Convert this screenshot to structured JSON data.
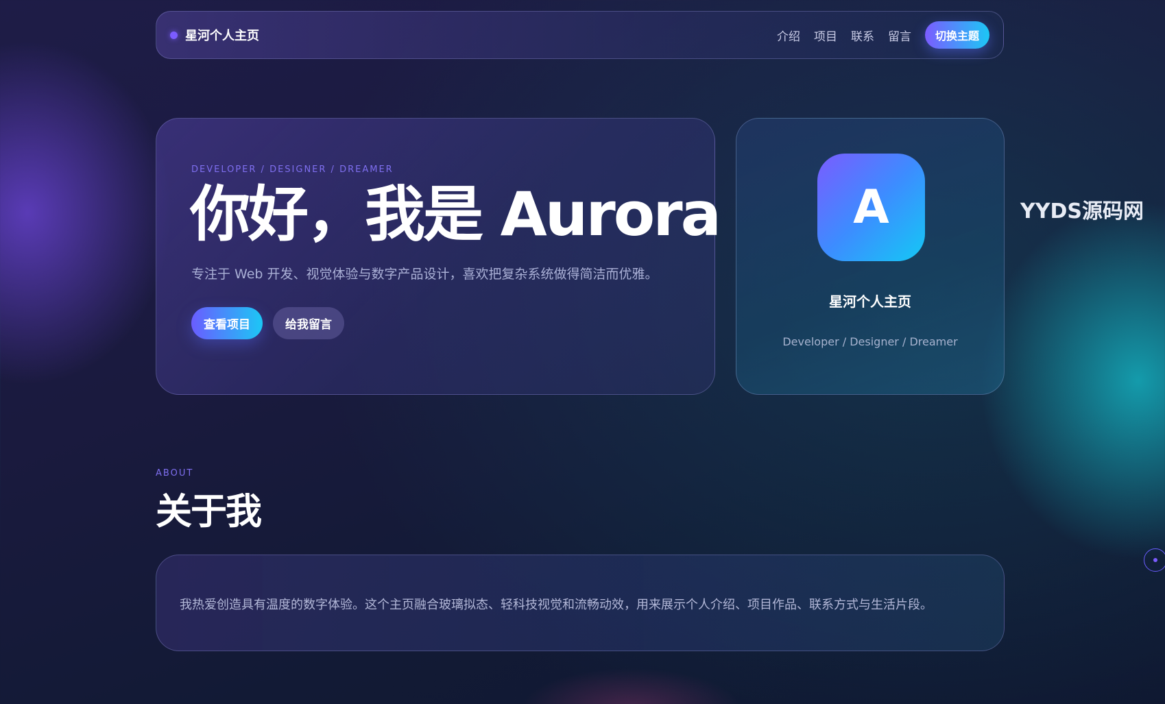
{
  "nav": {
    "brand": "星河个人主页",
    "links": [
      "介绍",
      "项目",
      "联系",
      "留言"
    ],
    "theme_button": "切换主题"
  },
  "hero": {
    "eyebrow": "DEVELOPER / DESIGNER / DREAMER",
    "title": "你好，我是 Aurora",
    "subtitle": "专注于 Web 开发、视觉体验与数字产品设计，喜欢把复杂系统做得简洁而优雅。",
    "primary_button": "查看项目",
    "secondary_button": "给我留言"
  },
  "profile": {
    "avatar_letter": "A",
    "name": "星河个人主页",
    "role": "Developer / Designer / Dreamer"
  },
  "watermark": "YYDS源码网",
  "about": {
    "eyebrow": "ABOUT",
    "title": "关于我",
    "text": "我热爱创造具有温度的数字体验。这个主页融合玻璃拟态、轻科技视觉和流畅动效，用来展示个人介绍、项目作品、联系方式与生活片段。"
  },
  "colors": {
    "accent_purple": "#7b5cff",
    "accent_cyan": "#1cc7f5",
    "eyebrow": "#7f6ff0"
  },
  "icons": {
    "brand": "brand-dot-icon",
    "side": "scroll-indicator-icon"
  }
}
